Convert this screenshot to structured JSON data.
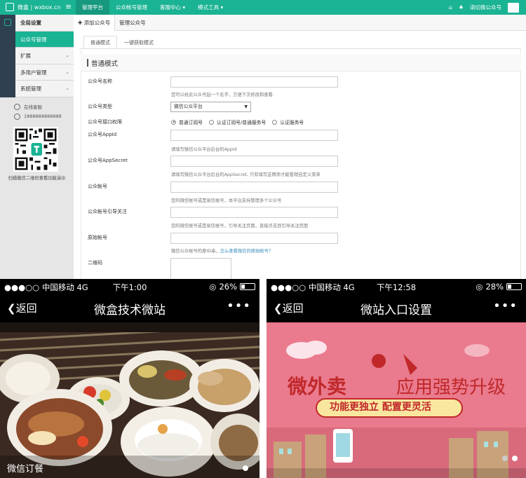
{
  "admin": {
    "logo_text": "微盒 | wxbox.cn",
    "top_nav": [
      "管理平台",
      "公众帐号管理",
      "客服中心 ▾",
      "模式工具 ▾"
    ],
    "account_label": "请切换公众号",
    "sub_tabs": [
      "✚ 添加公众号",
      "管理公众号"
    ],
    "sidebar": {
      "header": "全局设置",
      "items": [
        "公众号管理",
        "扩展",
        "多用户管理",
        "系统管理"
      ]
    },
    "contact": {
      "service_label": "在线客服",
      "phone": "1888888888888"
    },
    "qr_caption": "扫描微信二维码查看功能演示",
    "mode_tabs": [
      "普通模式",
      "一键获取模式"
    ],
    "section_title": "普通模式",
    "form": {
      "name_label": "公众号名称",
      "name_help": "您可以给此公众号起一个名字，方便下次修改和查看.",
      "type_label": "公众号类型",
      "type_value": "微信公众平台",
      "auth_label": "公众号接口权限",
      "auth_options": [
        "普通订阅号",
        "认证订阅号/普通服务号",
        "认证服务号"
      ],
      "appid_label": "公众号AppId",
      "appid_help": "请填写微信公众平台后台的AppId",
      "secret_label": "公众号AppSecret",
      "secret_help": "请填写微信公众平台后台的AppSecret, 只有填写这两项才能管理自定义菜单",
      "account_label": "公众帐号",
      "account_help": "您的微信帐号或是易信帐号，本平台支持管理多个公众号",
      "guide_label": "公众帐号引导关注",
      "guide_help": "您的微信帐号或是易信帐号，引导关注页面，直接点击到引导关注页面",
      "origin_label": "原始帐号",
      "origin_help": "微信公众帐号的原ID串，",
      "origin_link": "怎么查看微信的原始帐号？",
      "qrcode_label": "二维码"
    }
  },
  "phone_left": {
    "carrier": "●●●○○ 中国移动  4G",
    "time": "下午1:00",
    "battery": "26%",
    "battery_level": 0.26,
    "back_label": "返回",
    "title": "微盒技术微站",
    "more": "•••",
    "caption": "微信订餐"
  },
  "phone_right": {
    "carrier": "●●●○○ 中国移动  4G",
    "time": "下午12:58",
    "battery": "28%",
    "battery_level": 0.28,
    "back_label": "返回",
    "title": "微站入口设置",
    "more": "•••",
    "promo_title_a": "微外卖",
    "promo_title_b": "应用强势升级",
    "promo_sub": "功能更独立 配置更灵活"
  },
  "colors": {
    "brand": "#1ab394",
    "sidebar_dark": "#2f4050",
    "link": "#3c8dbc",
    "promo_red": "#c0282a"
  },
  "icons": [
    "grid-icon",
    "menu-icon",
    "home-icon",
    "bell-icon",
    "chat-icon",
    "phone-icon",
    "radio-icon",
    "signal-icon",
    "battery-icon",
    "back-chevron-icon"
  ]
}
